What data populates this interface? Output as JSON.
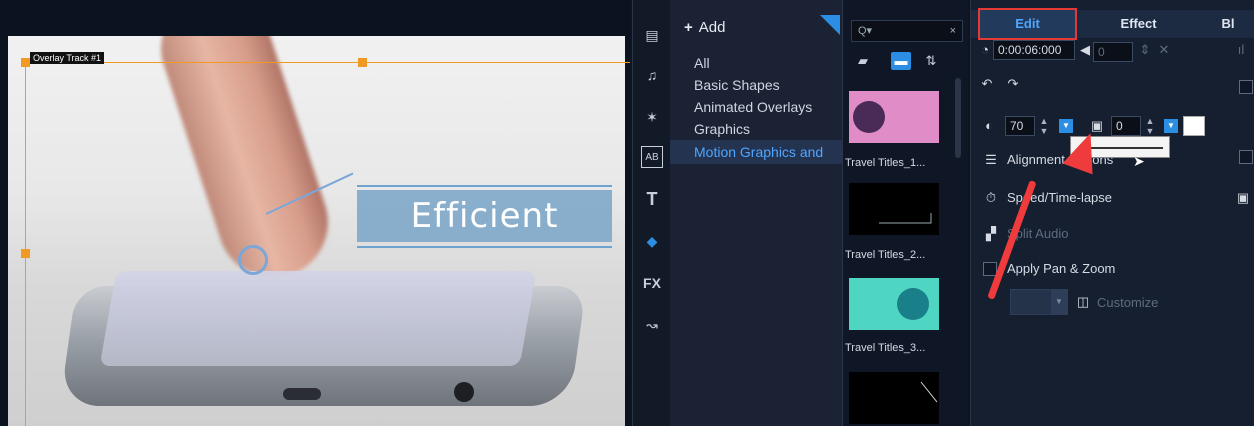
{
  "preview": {
    "track_label": "Overlay Track #1",
    "title_text": "Efficient"
  },
  "rail": {
    "icons": [
      "media-icon",
      "audio-icon",
      "transition-icon",
      "title-ab-icon",
      "text-icon",
      "overlay-icon",
      "fx-icon",
      "motion-path-icon"
    ],
    "fx_label": "FX",
    "text_label": "T",
    "ab_label": "AB"
  },
  "library": {
    "add_label": "Add",
    "items": [
      "All",
      "Basic Shapes",
      "Animated Overlays",
      "Graphics",
      "Motion Graphics and"
    ],
    "selected_index": 4
  },
  "thumbnails": {
    "search_placeholder": "Q▾",
    "items": [
      {
        "label": "Travel Titles_1...",
        "bg": "#e08cc6",
        "dot": "#4a2b57"
      },
      {
        "label": "Travel Titles_2...",
        "bg": "#000000",
        "dot": ""
      },
      {
        "label": "Travel Titles_3...",
        "bg": "#4fd6c3",
        "dot": "#197f88"
      },
      {
        "label": "",
        "bg": "#000000",
        "dot": ""
      }
    ]
  },
  "options": {
    "tabs": [
      "Edit",
      "Effect",
      "Bl"
    ],
    "active_tab": "Edit",
    "duration": "0:00:06:000",
    "volume": "0",
    "opacity_value": "70",
    "border_value": "0",
    "alignment_label": "Alignment Options",
    "speed_label": "Speed/Time-lapse",
    "split_audio_label": "Split Audio",
    "pan_zoom_label": "Apply Pan & Zoom",
    "customize_label": "Customize"
  },
  "colors": {
    "accent": "#2c8ee3",
    "highlight": "#e53935",
    "selection": "#f19a23"
  }
}
